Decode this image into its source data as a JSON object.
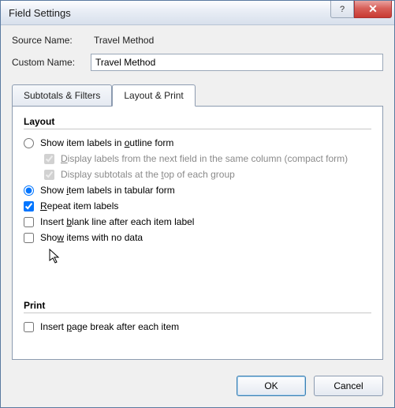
{
  "title": "Field Settings",
  "source_name_label": "Source Name:",
  "source_name_value": "Travel Method",
  "custom_name_label": "Custom Name:",
  "custom_name_value": "Travel Method",
  "tabs": {
    "subtotals": "Subtotals & Filters",
    "layout": "Layout & Print"
  },
  "sections": {
    "layout": "Layout",
    "print": "Print"
  },
  "options": {
    "outline_prefix": "Show item labels in ",
    "outline_und": "o",
    "outline_suffix": "utline form",
    "compact_und": "D",
    "compact_rest": "isplay labels from the next field in the same column (compact form)",
    "subtotals_prefix": "Display subtotals at the ",
    "subtotals_und": "t",
    "subtotals_suffix": "op of each group",
    "tabular_prefix": "Show ",
    "tabular_und": "i",
    "tabular_suffix": "tem labels in tabular form",
    "repeat_und": "R",
    "repeat_rest": "epeat item labels",
    "blank_prefix": "Insert ",
    "blank_und": "b",
    "blank_suffix": "lank line after each item label",
    "nodata_prefix": "Sho",
    "nodata_und": "w",
    "nodata_suffix": " items with no data",
    "pagebreak_prefix": "Insert ",
    "pagebreak_und": "p",
    "pagebreak_suffix": "age break after each item"
  },
  "buttons": {
    "ok": "OK",
    "cancel": "Cancel"
  }
}
